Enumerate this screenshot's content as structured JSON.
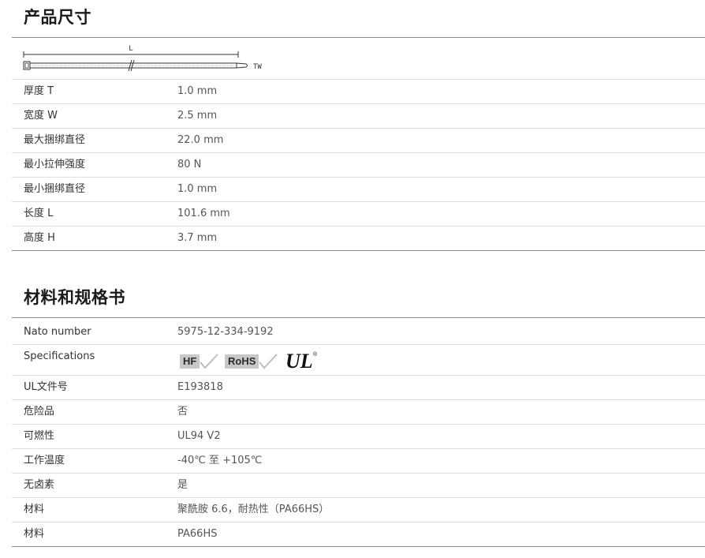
{
  "section1": {
    "title": "产品尺寸",
    "diagram": {
      "length_label": "L",
      "side_label": "TW"
    },
    "rows": [
      {
        "label": "厚度 T",
        "value": "1.0 mm"
      },
      {
        "label": "宽度 W",
        "value": "2.5 mm"
      },
      {
        "label": "最大捆绑直径",
        "value": "22.0 mm"
      },
      {
        "label": "最小拉伸强度",
        "value": "80 N"
      },
      {
        "label": "最小捆绑直径",
        "value": "1.0 mm"
      },
      {
        "label": "长度 L",
        "value": "101.6 mm"
      },
      {
        "label": "高度 H",
        "value": "3.7 mm"
      }
    ]
  },
  "section2": {
    "title": "材料和规格书",
    "nato": {
      "label": "Nato number",
      "value": "5975-12-334-9192"
    },
    "specifications": {
      "label": "Specifications",
      "badges": [
        "HF",
        "RoHS"
      ],
      "ul_logo_text": "UL",
      "ul_registered": "®"
    },
    "rows": [
      {
        "label": "UL文件号",
        "value": "E193818"
      },
      {
        "label": "危险品",
        "value": "否"
      },
      {
        "label": "可燃性",
        "value": "UL94 V2"
      },
      {
        "label": "工作温度",
        "value": "-40℃ 至 +105℃"
      },
      {
        "label": "无卤素",
        "value": "是"
      },
      {
        "label": "材料",
        "value": "聚酰胺 6.6，耐热性（PA66HS）"
      },
      {
        "label": "材料",
        "value": "PA66HS"
      }
    ]
  },
  "colors": {
    "rule": "#8a8a8a",
    "row_border": "#dedede",
    "badge_bg": "#c8c8c8",
    "text": "#333333"
  }
}
